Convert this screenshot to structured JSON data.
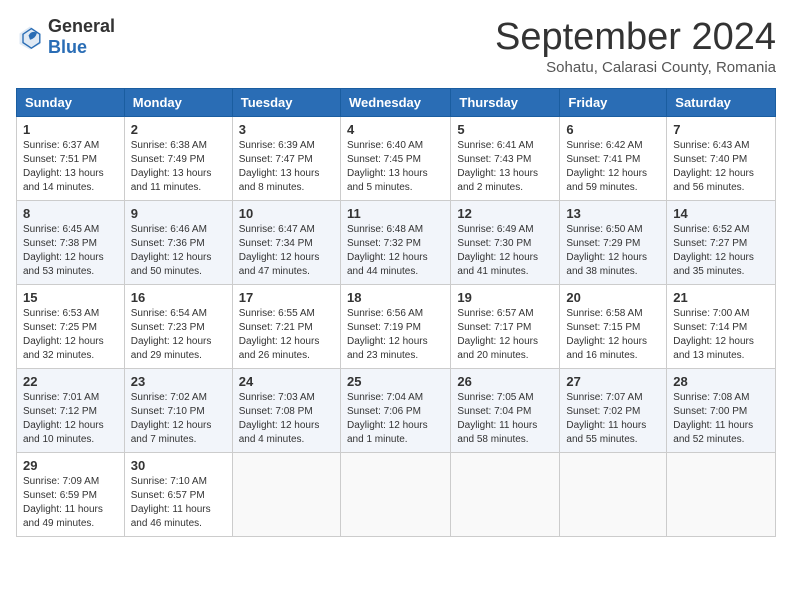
{
  "header": {
    "logo_general": "General",
    "logo_blue": "Blue",
    "month_title": "September 2024",
    "location": "Sohatu, Calarasi County, Romania"
  },
  "weekdays": [
    "Sunday",
    "Monday",
    "Tuesday",
    "Wednesday",
    "Thursday",
    "Friday",
    "Saturday"
  ],
  "weeks": [
    [
      {
        "day": "1",
        "lines": [
          "Sunrise: 6:37 AM",
          "Sunset: 7:51 PM",
          "Daylight: 13 hours",
          "and 14 minutes."
        ]
      },
      {
        "day": "2",
        "lines": [
          "Sunrise: 6:38 AM",
          "Sunset: 7:49 PM",
          "Daylight: 13 hours",
          "and 11 minutes."
        ]
      },
      {
        "day": "3",
        "lines": [
          "Sunrise: 6:39 AM",
          "Sunset: 7:47 PM",
          "Daylight: 13 hours",
          "and 8 minutes."
        ]
      },
      {
        "day": "4",
        "lines": [
          "Sunrise: 6:40 AM",
          "Sunset: 7:45 PM",
          "Daylight: 13 hours",
          "and 5 minutes."
        ]
      },
      {
        "day": "5",
        "lines": [
          "Sunrise: 6:41 AM",
          "Sunset: 7:43 PM",
          "Daylight: 13 hours",
          "and 2 minutes."
        ]
      },
      {
        "day": "6",
        "lines": [
          "Sunrise: 6:42 AM",
          "Sunset: 7:41 PM",
          "Daylight: 12 hours",
          "and 59 minutes."
        ]
      },
      {
        "day": "7",
        "lines": [
          "Sunrise: 6:43 AM",
          "Sunset: 7:40 PM",
          "Daylight: 12 hours",
          "and 56 minutes."
        ]
      }
    ],
    [
      {
        "day": "8",
        "lines": [
          "Sunrise: 6:45 AM",
          "Sunset: 7:38 PM",
          "Daylight: 12 hours",
          "and 53 minutes."
        ]
      },
      {
        "day": "9",
        "lines": [
          "Sunrise: 6:46 AM",
          "Sunset: 7:36 PM",
          "Daylight: 12 hours",
          "and 50 minutes."
        ]
      },
      {
        "day": "10",
        "lines": [
          "Sunrise: 6:47 AM",
          "Sunset: 7:34 PM",
          "Daylight: 12 hours",
          "and 47 minutes."
        ]
      },
      {
        "day": "11",
        "lines": [
          "Sunrise: 6:48 AM",
          "Sunset: 7:32 PM",
          "Daylight: 12 hours",
          "and 44 minutes."
        ]
      },
      {
        "day": "12",
        "lines": [
          "Sunrise: 6:49 AM",
          "Sunset: 7:30 PM",
          "Daylight: 12 hours",
          "and 41 minutes."
        ]
      },
      {
        "day": "13",
        "lines": [
          "Sunrise: 6:50 AM",
          "Sunset: 7:29 PM",
          "Daylight: 12 hours",
          "and 38 minutes."
        ]
      },
      {
        "day": "14",
        "lines": [
          "Sunrise: 6:52 AM",
          "Sunset: 7:27 PM",
          "Daylight: 12 hours",
          "and 35 minutes."
        ]
      }
    ],
    [
      {
        "day": "15",
        "lines": [
          "Sunrise: 6:53 AM",
          "Sunset: 7:25 PM",
          "Daylight: 12 hours",
          "and 32 minutes."
        ]
      },
      {
        "day": "16",
        "lines": [
          "Sunrise: 6:54 AM",
          "Sunset: 7:23 PM",
          "Daylight: 12 hours",
          "and 29 minutes."
        ]
      },
      {
        "day": "17",
        "lines": [
          "Sunrise: 6:55 AM",
          "Sunset: 7:21 PM",
          "Daylight: 12 hours",
          "and 26 minutes."
        ]
      },
      {
        "day": "18",
        "lines": [
          "Sunrise: 6:56 AM",
          "Sunset: 7:19 PM",
          "Daylight: 12 hours",
          "and 23 minutes."
        ]
      },
      {
        "day": "19",
        "lines": [
          "Sunrise: 6:57 AM",
          "Sunset: 7:17 PM",
          "Daylight: 12 hours",
          "and 20 minutes."
        ]
      },
      {
        "day": "20",
        "lines": [
          "Sunrise: 6:58 AM",
          "Sunset: 7:15 PM",
          "Daylight: 12 hours",
          "and 16 minutes."
        ]
      },
      {
        "day": "21",
        "lines": [
          "Sunrise: 7:00 AM",
          "Sunset: 7:14 PM",
          "Daylight: 12 hours",
          "and 13 minutes."
        ]
      }
    ],
    [
      {
        "day": "22",
        "lines": [
          "Sunrise: 7:01 AM",
          "Sunset: 7:12 PM",
          "Daylight: 12 hours",
          "and 10 minutes."
        ]
      },
      {
        "day": "23",
        "lines": [
          "Sunrise: 7:02 AM",
          "Sunset: 7:10 PM",
          "Daylight: 12 hours",
          "and 7 minutes."
        ]
      },
      {
        "day": "24",
        "lines": [
          "Sunrise: 7:03 AM",
          "Sunset: 7:08 PM",
          "Daylight: 12 hours",
          "and 4 minutes."
        ]
      },
      {
        "day": "25",
        "lines": [
          "Sunrise: 7:04 AM",
          "Sunset: 7:06 PM",
          "Daylight: 12 hours",
          "and 1 minute."
        ]
      },
      {
        "day": "26",
        "lines": [
          "Sunrise: 7:05 AM",
          "Sunset: 7:04 PM",
          "Daylight: 11 hours",
          "and 58 minutes."
        ]
      },
      {
        "day": "27",
        "lines": [
          "Sunrise: 7:07 AM",
          "Sunset: 7:02 PM",
          "Daylight: 11 hours",
          "and 55 minutes."
        ]
      },
      {
        "day": "28",
        "lines": [
          "Sunrise: 7:08 AM",
          "Sunset: 7:00 PM",
          "Daylight: 11 hours",
          "and 52 minutes."
        ]
      }
    ],
    [
      {
        "day": "29",
        "lines": [
          "Sunrise: 7:09 AM",
          "Sunset: 6:59 PM",
          "Daylight: 11 hours",
          "and 49 minutes."
        ]
      },
      {
        "day": "30",
        "lines": [
          "Sunrise: 7:10 AM",
          "Sunset: 6:57 PM",
          "Daylight: 11 hours",
          "and 46 minutes."
        ]
      },
      {
        "day": "",
        "lines": []
      },
      {
        "day": "",
        "lines": []
      },
      {
        "day": "",
        "lines": []
      },
      {
        "day": "",
        "lines": []
      },
      {
        "day": "",
        "lines": []
      }
    ]
  ]
}
